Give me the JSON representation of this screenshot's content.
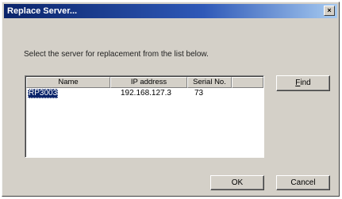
{
  "window": {
    "title": "Replace Server...",
    "close_glyph": "×"
  },
  "instruction": "Select the server for replacement from the list below.",
  "list": {
    "columns": [
      "Name",
      "IP address",
      "Serial No."
    ],
    "rows": [
      {
        "name": "RP3003",
        "ip": "192.168.127.3",
        "serial": "73",
        "selected": true
      }
    ]
  },
  "buttons": {
    "find": "Find",
    "ok": "OK",
    "cancel": "Cancel"
  },
  "colors": {
    "titlebar": "#0a246a",
    "face": "#d4d0c8",
    "selection": "#0a246a"
  }
}
